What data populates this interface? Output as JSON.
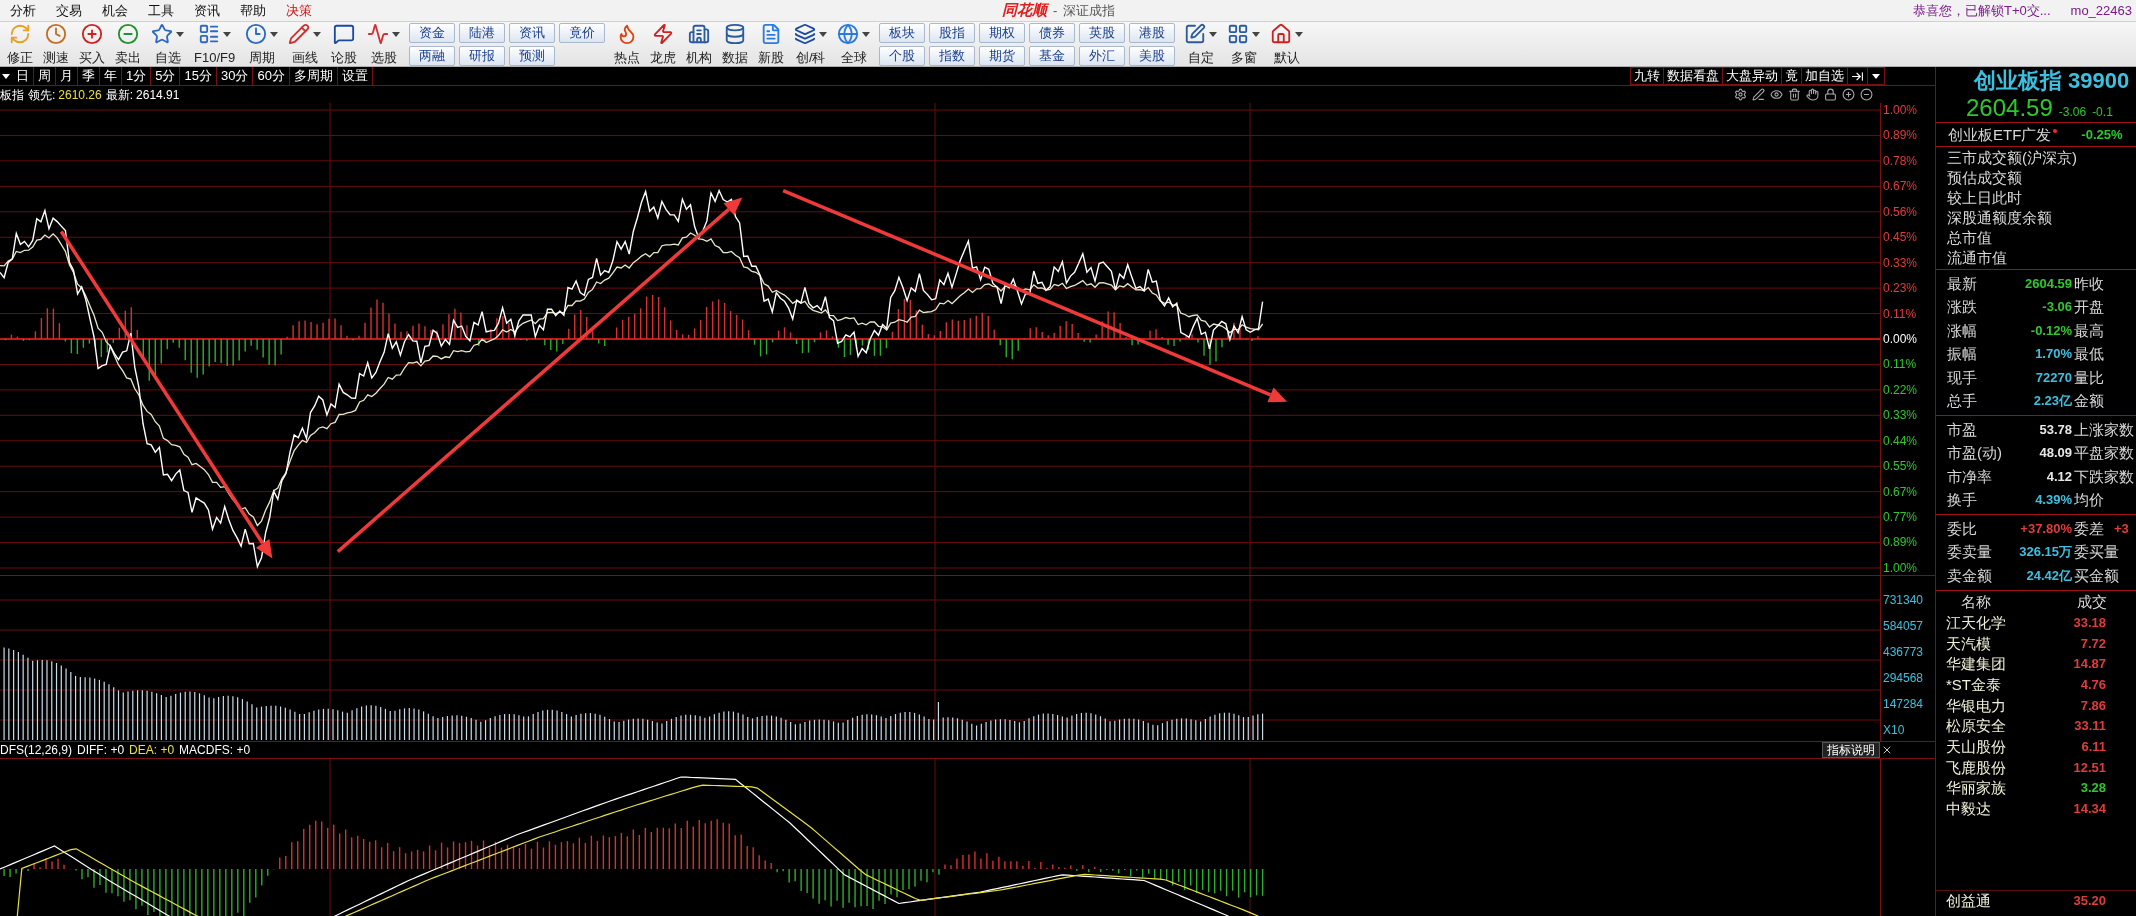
{
  "menu": [
    "分析",
    "交易",
    "机会",
    "工具",
    "资讯",
    "帮助",
    "决策"
  ],
  "title": {
    "app": "同花顺",
    "separator": "-",
    "name": "深证成指"
  },
  "notice": "恭喜您，已解锁T+0交...",
  "user": "mo_22463",
  "toolbar": [
    {
      "kind": "tools",
      "items": [
        {
          "label": "修正",
          "kind": "fix",
          "dropdown": false
        },
        {
          "label": "测速",
          "kind": "speed",
          "dropdown": false
        },
        {
          "label": "买入",
          "kind": "buy",
          "dropdown": false
        },
        {
          "label": "卖出",
          "kind": "sell",
          "dropdown": false
        },
        {
          "label": "自选",
          "kind": "watch",
          "dropdown": true
        },
        {
          "label": "F10/F9",
          "kind": "f10",
          "dropdown": true
        },
        {
          "label": "周期",
          "kind": "period",
          "dropdown": true
        },
        {
          "label": "画线",
          "kind": "draw",
          "dropdown": true
        },
        {
          "label": "论股",
          "kind": "forum",
          "dropdown": false
        },
        {
          "label": "选股",
          "kind": "pick",
          "dropdown": true
        }
      ]
    },
    {
      "kind": "quick",
      "items": [
        [
          "资金",
          "两融"
        ],
        [
          "陆港",
          "研报"
        ],
        [
          "资讯",
          "预测"
        ],
        [
          "竟价"
        ]
      ]
    },
    {
      "kind": "tools",
      "items": [
        {
          "label": "热点",
          "kind": "hot",
          "dropdown": false
        },
        {
          "label": "龙虎",
          "kind": "dragon",
          "dropdown": false
        },
        {
          "label": "机构",
          "kind": "org",
          "dropdown": false
        },
        {
          "label": "数据",
          "kind": "data",
          "dropdown": false
        },
        {
          "label": "新股",
          "kind": "ipo",
          "dropdown": false
        },
        {
          "label": "创/科",
          "kind": "board",
          "dropdown": true
        },
        {
          "label": "全球",
          "kind": "globe",
          "dropdown": true
        }
      ]
    },
    {
      "kind": "quick",
      "items": [
        [
          "板块",
          "个股"
        ],
        [
          "股指",
          "指数"
        ],
        [
          "期权",
          "期货"
        ],
        [
          "债券",
          "基金"
        ],
        [
          "英股",
          "外汇"
        ],
        [
          "港股",
          "美股"
        ]
      ]
    },
    {
      "kind": "tools",
      "items": [
        {
          "label": "自定",
          "kind": "custom",
          "dropdown": true
        },
        {
          "label": "多窗",
          "kind": "windows",
          "dropdown": true
        },
        {
          "label": "默认",
          "kind": "home",
          "dropdown": true
        }
      ]
    }
  ],
  "periods": [
    "日",
    "周",
    "月",
    "季",
    "年",
    "1分",
    "5分",
    "15分",
    "30分",
    "60分",
    "多周期",
    "设置"
  ],
  "chart_tools": [
    "九转",
    "数据看盘",
    "大盘异动",
    "竟",
    "加自选"
  ],
  "info_line": {
    "name": "板指",
    "lead_label": "领先:",
    "lead": "2610.26",
    "last_label": "最新:",
    "last": "2614.91"
  },
  "price_axis": [
    {
      "label": "1.00%",
      "color": "#e03c3c"
    },
    {
      "label": "0.89%",
      "color": "#e03c3c"
    },
    {
      "label": "0.78%",
      "color": "#e03c3c"
    },
    {
      "label": "0.67%",
      "color": "#e03c3c"
    },
    {
      "label": "0.56%",
      "color": "#e03c3c"
    },
    {
      "label": "0.45%",
      "color": "#e03c3c"
    },
    {
      "label": "0.33%",
      "color": "#e03c3c"
    },
    {
      "label": "0.23%",
      "color": "#e03c3c"
    },
    {
      "label": "0.11%",
      "color": "#e03c3c"
    },
    {
      "label": "0.00%",
      "color": "#ffffff"
    },
    {
      "label": "0.11%",
      "color": "#2ec82e"
    },
    {
      "label": "0.22%",
      "color": "#2ec82e"
    },
    {
      "label": "0.33%",
      "color": "#2ec82e"
    },
    {
      "label": "0.44%",
      "color": "#2ec82e"
    },
    {
      "label": "0.55%",
      "color": "#2ec82e"
    },
    {
      "label": "0.67%",
      "color": "#2ec82e"
    },
    {
      "label": "0.77%",
      "color": "#2ec82e"
    },
    {
      "label": "0.89%",
      "color": "#2ec82e"
    },
    {
      "label": "1.00%",
      "color": "#2ec82e"
    }
  ],
  "volume_axis": [
    "731340",
    "584057",
    "436773",
    "294568",
    "147284"
  ],
  "volume_multiplier": "X10",
  "macd": {
    "name": "DFS(12,26,9)",
    "items": [
      {
        "label": "DIFF:",
        "value": "+0",
        "color": "#ffffff"
      },
      {
        "label": "DEA:",
        "value": "+0",
        "color": "#e8e040"
      },
      {
        "label": "MACDFS:",
        "value": "+0",
        "color": "#ffffff"
      }
    ],
    "help": "指标说明"
  },
  "quote": {
    "title": "创业板指 39900",
    "price": "2604.59",
    "change": "-3.06",
    "percent": "-0.1",
    "etf": {
      "name": "创业板ETF广发",
      "value": "-0.25%"
    },
    "market": [
      "三市成交额(沪深京)",
      "预估成交额",
      "较上日此时",
      "深股通额度余额",
      "总市值",
      "流通市值"
    ],
    "sections": [
      [
        {
          "label": "最新",
          "value": "2604.59",
          "color": "#2ec82e",
          "label2": "昨收"
        },
        {
          "label": "涨跌",
          "value": "-3.06",
          "color": "#2ec82e",
          "label2": "开盘"
        },
        {
          "label": "涨幅",
          "value": "-0.12%",
          "color": "#2ec82e",
          "label2": "最高"
        },
        {
          "label": "振幅",
          "value": "1.70%",
          "color": "#3cc0e0",
          "label2": "最低"
        },
        {
          "label": "现手",
          "value": "72270",
          "color": "#3cc0e0",
          "label2": "量比"
        },
        {
          "label": "总手",
          "value": "2.23亿",
          "color": "#3cc0e0",
          "label2": "金额"
        }
      ],
      [
        {
          "label": "市盈",
          "value": "53.78",
          "color": "#e8e8e8",
          "label2": "上涨家数"
        },
        {
          "label": "市盈(动)",
          "value": "48.09",
          "color": "#e8e8e8",
          "label2": "平盘家数"
        },
        {
          "label": "市净率",
          "value": "4.12",
          "color": "#e8e8e8",
          "label2": "下跌家数"
        },
        {
          "label": "换手",
          "value": "4.39%",
          "color": "#3cc0e0",
          "label2": "均价"
        }
      ],
      [
        {
          "label": "委比",
          "value": "+37.80%",
          "color": "#e03c3c",
          "label2": "委差",
          "value2": "+3"
        },
        {
          "label": "委卖量",
          "value": "326.15万",
          "color": "#3cc0e0",
          "label2": "委买量"
        },
        {
          "label": "卖金额",
          "value": "24.42亿",
          "color": "#3cc0e0",
          "label2": "买金额"
        }
      ]
    ]
  },
  "stocks": {
    "columns": [
      "名称",
      "成交"
    ],
    "rows": [
      {
        "name": "江天化学",
        "price": "33.18",
        "color": "#e03c3c"
      },
      {
        "name": "天汽模",
        "price": "7.72",
        "color": "#e03c3c"
      },
      {
        "name": "华建集团",
        "price": "14.87",
        "color": "#e03c3c"
      },
      {
        "name": "*ST金泰",
        "price": "4.76",
        "color": "#e03c3c"
      },
      {
        "name": "华银电力",
        "price": "7.86",
        "color": "#e03c3c"
      },
      {
        "name": "松原安全",
        "price": "33.11",
        "color": "#e03c3c"
      },
      {
        "name": "天山股份",
        "price": "6.11",
        "color": "#e03c3c"
      },
      {
        "name": "飞鹿股份",
        "price": "12.51",
        "color": "#e03c3c"
      },
      {
        "name": "华丽家族",
        "price": "3.28",
        "color": "#2ec82e"
      },
      {
        "name": "中毅达",
        "price": "14.34",
        "color": "#e03c3c"
      }
    ],
    "last": {
      "name": "创益通",
      "price": "35.20",
      "color": "#e03c3c"
    }
  }
}
